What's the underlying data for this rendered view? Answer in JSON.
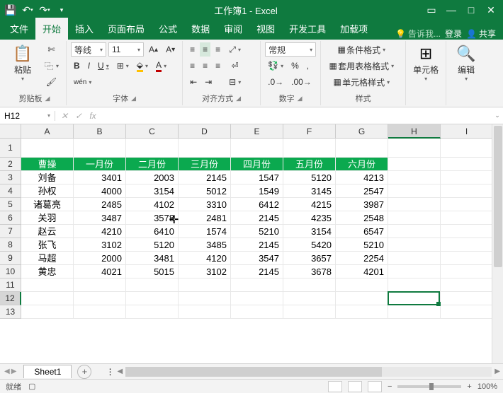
{
  "title": "工作簿1 - Excel",
  "tabs": {
    "file": "文件",
    "home": "开始",
    "insert": "插入",
    "pagelayout": "页面布局",
    "formulas": "公式",
    "data": "数据",
    "review": "审阅",
    "view": "视图",
    "developer": "开发工具",
    "addins": "加载项",
    "tellme": "告诉我...",
    "signin": "登录",
    "share": "共享"
  },
  "ribbon": {
    "clipboard": {
      "label": "剪贴板",
      "paste": "粘贴"
    },
    "font": {
      "label": "字体",
      "name": "等线",
      "size": "11",
      "bold": "B",
      "italic": "I",
      "underline": "U"
    },
    "align": {
      "label": "对齐方式"
    },
    "number": {
      "label": "数字",
      "format": "常规"
    },
    "styles": {
      "label": "样式",
      "conditional": "条件格式",
      "table": "套用表格格式",
      "cellstyles": "单元格样式"
    },
    "cells": {
      "label": "单元格"
    },
    "editing": {
      "label": "编辑"
    }
  },
  "namebox": "H12",
  "columns": [
    "A",
    "B",
    "C",
    "D",
    "E",
    "F",
    "G",
    "H",
    "I"
  ],
  "rows": [
    "1",
    "2",
    "3",
    "4",
    "5",
    "6",
    "7",
    "8",
    "9",
    "10",
    "11",
    "12",
    "13"
  ],
  "header_row": [
    "曹操",
    "一月份",
    "二月份",
    "三月份",
    "四月份",
    "五月份",
    "六月份"
  ],
  "data_rows": [
    [
      "刘备",
      "3401",
      "2003",
      "2145",
      "1547",
      "5120",
      "4213"
    ],
    [
      "孙权",
      "4000",
      "3154",
      "5012",
      "1549",
      "3145",
      "2547"
    ],
    [
      "诸葛亮",
      "2485",
      "4102",
      "3310",
      "6412",
      "4215",
      "3987"
    ],
    [
      "关羽",
      "3487",
      "3578",
      "2481",
      "2145",
      "4235",
      "2548"
    ],
    [
      "赵云",
      "4210",
      "6410",
      "1574",
      "5210",
      "3154",
      "6547"
    ],
    [
      "张飞",
      "3102",
      "5120",
      "3485",
      "2145",
      "5420",
      "5210"
    ],
    [
      "马超",
      "2000",
      "3481",
      "4120",
      "3547",
      "3657",
      "2254"
    ],
    [
      "黄忠",
      "4021",
      "5015",
      "3102",
      "2145",
      "3678",
      "4201"
    ]
  ],
  "sheet": {
    "name": "Sheet1"
  },
  "status": {
    "ready": "就绪",
    "zoom": "100%"
  },
  "selected": {
    "col": "H",
    "row": "12"
  }
}
